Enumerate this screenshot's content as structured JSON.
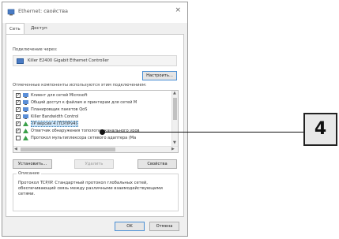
{
  "window": {
    "title": "Ethernet: свойства",
    "close_glyph": "×"
  },
  "tabs": [
    {
      "label": "Сеть"
    },
    {
      "label": "Доступ"
    }
  ],
  "connect_label": "Подключение через:",
  "adapter": {
    "name": "Killer E2400 Gigabit Ethernet Controller"
  },
  "configure_button": "Настроить...",
  "components_label": "Отмеченные компоненты используются этим подключением:",
  "components": [
    {
      "label": "Клиент для сетей Microsoft",
      "checked": true,
      "icon": "network-client-icon"
    },
    {
      "label": "Общий доступ к файлам и принтерам для сетей M",
      "checked": true,
      "icon": "network-service-icon"
    },
    {
      "label": "Планировщик пакетов QoS",
      "checked": true,
      "icon": "network-service-icon"
    },
    {
      "label": "Killer Bandwidth Control",
      "checked": true,
      "icon": "network-service-icon"
    },
    {
      "label": "IP версии 4 (TCP/IPv4)",
      "checked": true,
      "icon": "protocol-icon",
      "selected": true
    },
    {
      "label": "Ответчик обнаружения топологии канального уров",
      "checked": true,
      "icon": "protocol-icon"
    },
    {
      "label": "Протокол мультиплексора сетевого адаптера (Ма",
      "checked": false,
      "icon": "protocol-icon"
    }
  ],
  "buttons": {
    "install": "Установить...",
    "remove": "Удалить",
    "properties": "Свойства",
    "ok": "OK",
    "cancel": "Отмена"
  },
  "description": {
    "title": "Описание",
    "text": "Протокол TCP/IP. Стандартный протокол глобальных сетей, обеспечивающий связь между различными взаимодействующими сетями."
  },
  "callout": {
    "number": "4"
  },
  "colors": {
    "accent": "#4a7bc4",
    "selection": "#cce4f7",
    "callout_bg": "#e8e8e8"
  }
}
